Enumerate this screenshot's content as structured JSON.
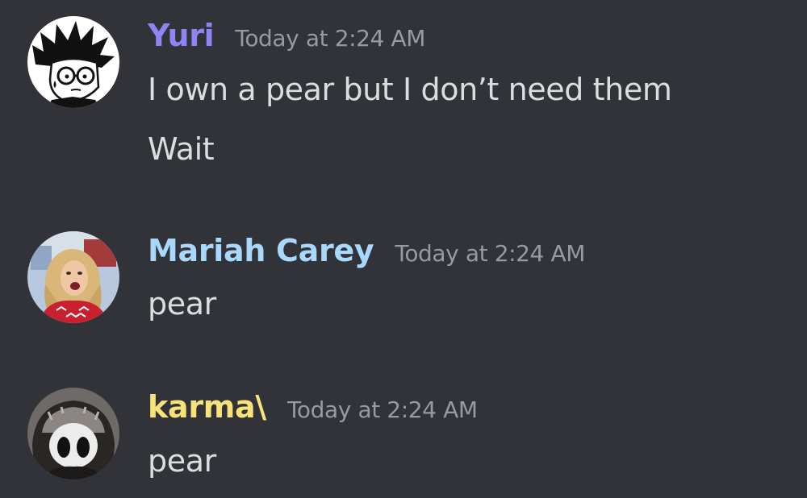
{
  "theme": {
    "background": "#313338",
    "text": "#dbdee1",
    "timestamp": "#989aa2"
  },
  "messages": [
    {
      "username": "Yuri",
      "username_color": "#8c85f2",
      "avatar_icon": "cartoon-boy-with-glasses-avatar",
      "timestamp": "Today at 2:24 AM",
      "lines": [
        "I own a pear but I don’t need them",
        "Wait"
      ]
    },
    {
      "username": "Mariah Carey",
      "username_color": "#a8d8fb",
      "avatar_icon": "woman-in-red-sweater-avatar",
      "timestamp": "Today at 2:24 AM",
      "lines": [
        "pear"
      ]
    },
    {
      "username": "karma\\",
      "username_color": "#f8e27a",
      "avatar_icon": "hooded-knight-avatar",
      "timestamp": "Today at 2:24 AM",
      "lines": [
        "pear"
      ]
    }
  ]
}
